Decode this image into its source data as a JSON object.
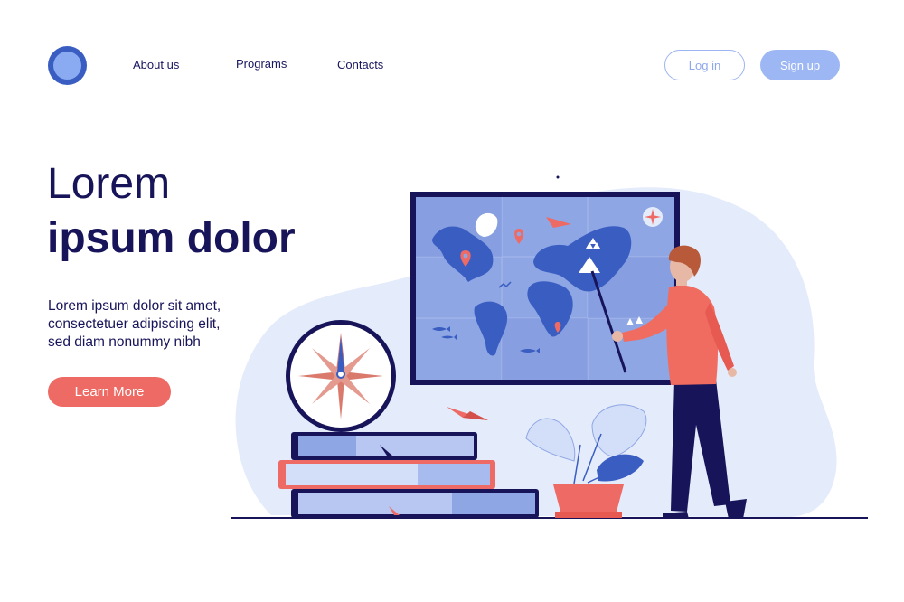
{
  "header": {
    "logo_icon": "circle-logo-icon",
    "nav": [
      {
        "label": "About us"
      },
      {
        "label": "Programs"
      },
      {
        "label": "Contacts"
      }
    ],
    "login_label": "Log in",
    "signup_label": "Sign up"
  },
  "hero": {
    "title_line1": "Lorem",
    "title_line2": "ipsum dolor",
    "body_lines": [
      "Lorem ipsum dolor sit amet,",
      "consectetuer adipiscing elit,",
      "sed diam nonummy nibh"
    ],
    "cta_label": "Learn More"
  },
  "illustration": {
    "elements": [
      "world-map-board",
      "compass-icon",
      "book-stack",
      "potted-plant",
      "teacher-figure",
      "paper-plane-icon",
      "map-pin-icon"
    ]
  },
  "colors": {
    "navy": "#17145a",
    "accent": "#ee6a64",
    "blue": "#3a5dc2",
    "light_blue": "#9db7f4",
    "blob": "#e4ebfb"
  }
}
